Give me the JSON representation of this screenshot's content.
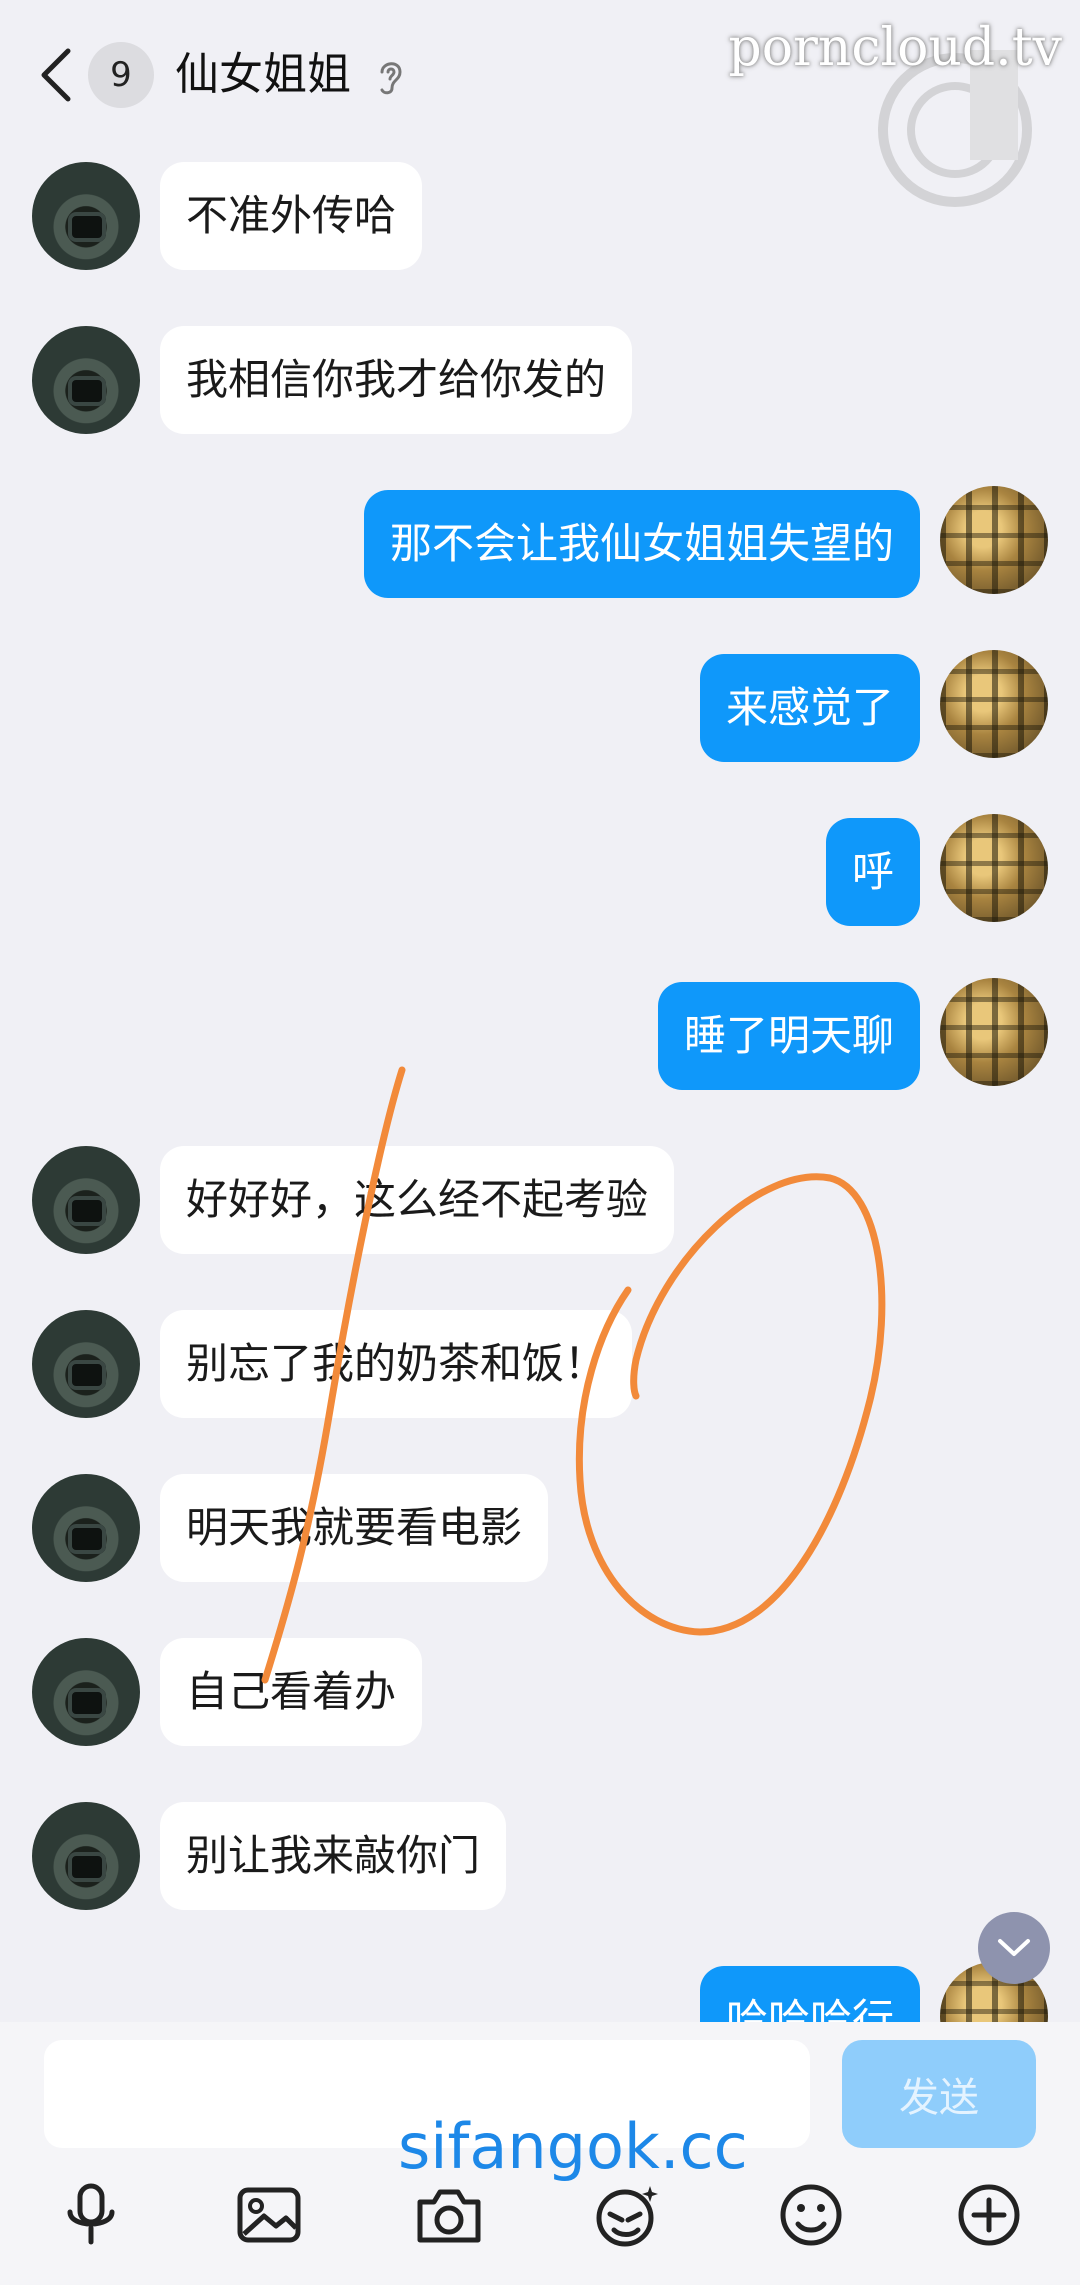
{
  "header": {
    "unread_count": "9",
    "title": "仙女姐姐"
  },
  "watermarks": {
    "top": "porncloud.tv",
    "bottom": "sifangok.cc"
  },
  "messages": [
    {
      "side": "other",
      "text": "不准外传哈"
    },
    {
      "side": "other",
      "text": "我相信你我才给你发的"
    },
    {
      "side": "self",
      "text": "那不会让我仙女姐姐失望的"
    },
    {
      "side": "self",
      "text": "来感觉了"
    },
    {
      "side": "self",
      "text": "呼"
    },
    {
      "side": "self",
      "text": "睡了明天聊"
    },
    {
      "side": "other",
      "text": "好好好，这么经不起考验"
    },
    {
      "side": "other",
      "text": "别忘了我的奶茶和饭！"
    },
    {
      "side": "other",
      "text": "明天我就要看电影"
    },
    {
      "side": "other",
      "text": "自己看着办"
    },
    {
      "side": "other",
      "text": "别让我来敲你门"
    },
    {
      "side": "self",
      "text": "哈哈哈行"
    }
  ],
  "input": {
    "value": "",
    "placeholder": "",
    "send_label": "发送"
  },
  "toolbar": {
    "icons": [
      "microphone-icon",
      "image-icon",
      "camera-icon",
      "emoji-face-icon",
      "smiley-icon",
      "plus-icon"
    ]
  },
  "colors": {
    "background": "#f0f0f5",
    "self_bubble": "#0f98fa",
    "other_bubble": "#ffffff",
    "send_disabled": "#8fcdfb",
    "annotation": "#f28a3a"
  }
}
